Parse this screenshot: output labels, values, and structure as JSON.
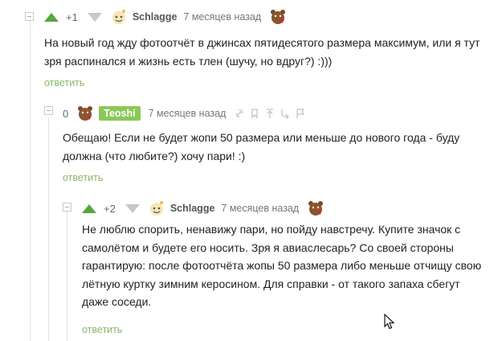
{
  "colors": {
    "upvote": "#55a63c",
    "downvote": "#c8c8c8",
    "reply": "#8ab86a",
    "highlight": "#8ac858"
  },
  "comments": [
    {
      "rating": "+1",
      "author": "Schlagge",
      "time": "7 месяцев назад",
      "lines": [
        "На новый год жду фотоотчёт в джинсах пятидесятого размера максимум, или я тут",
        "зря распинался и жизнь есть тлен (шучу, но вдруг?) :)))"
      ],
      "reply": "ответить"
    },
    {
      "rating": "0",
      "author": "Teoshi",
      "time": "7 месяцев назад",
      "lines": [
        "Обещаю! Если не будет жопи 50 размера или меньше до нового года - буду",
        "должна (что любите?) хочу пари! :)"
      ],
      "reply": "ответить"
    },
    {
      "rating": "+2",
      "author": "Schlagge",
      "time": "7 месяцев назад",
      "lines": [
        "Не люблю спорить, ненавижу пари, но пойду навстречу. Купите значок с",
        "самолётом и будете его носить. Зря я авиаслесарь? Со своей стороны",
        "гарантирую: после фотоотчёта жопы 50 размера либо меньше отчищу свою",
        "лётную куртку зимним керосином. Для справки - от такого запаха сбегут",
        "даже соседи."
      ],
      "reply": "ответить"
    }
  ],
  "icons": [
    "upvote-arrow-icon",
    "downvote-arrow-icon",
    "avatar-icon",
    "bear-icon",
    "link-icon",
    "bookmark-icon",
    "arrow-up-icon",
    "branch-icon",
    "flag-icon",
    "mouse-cursor-icon"
  ]
}
